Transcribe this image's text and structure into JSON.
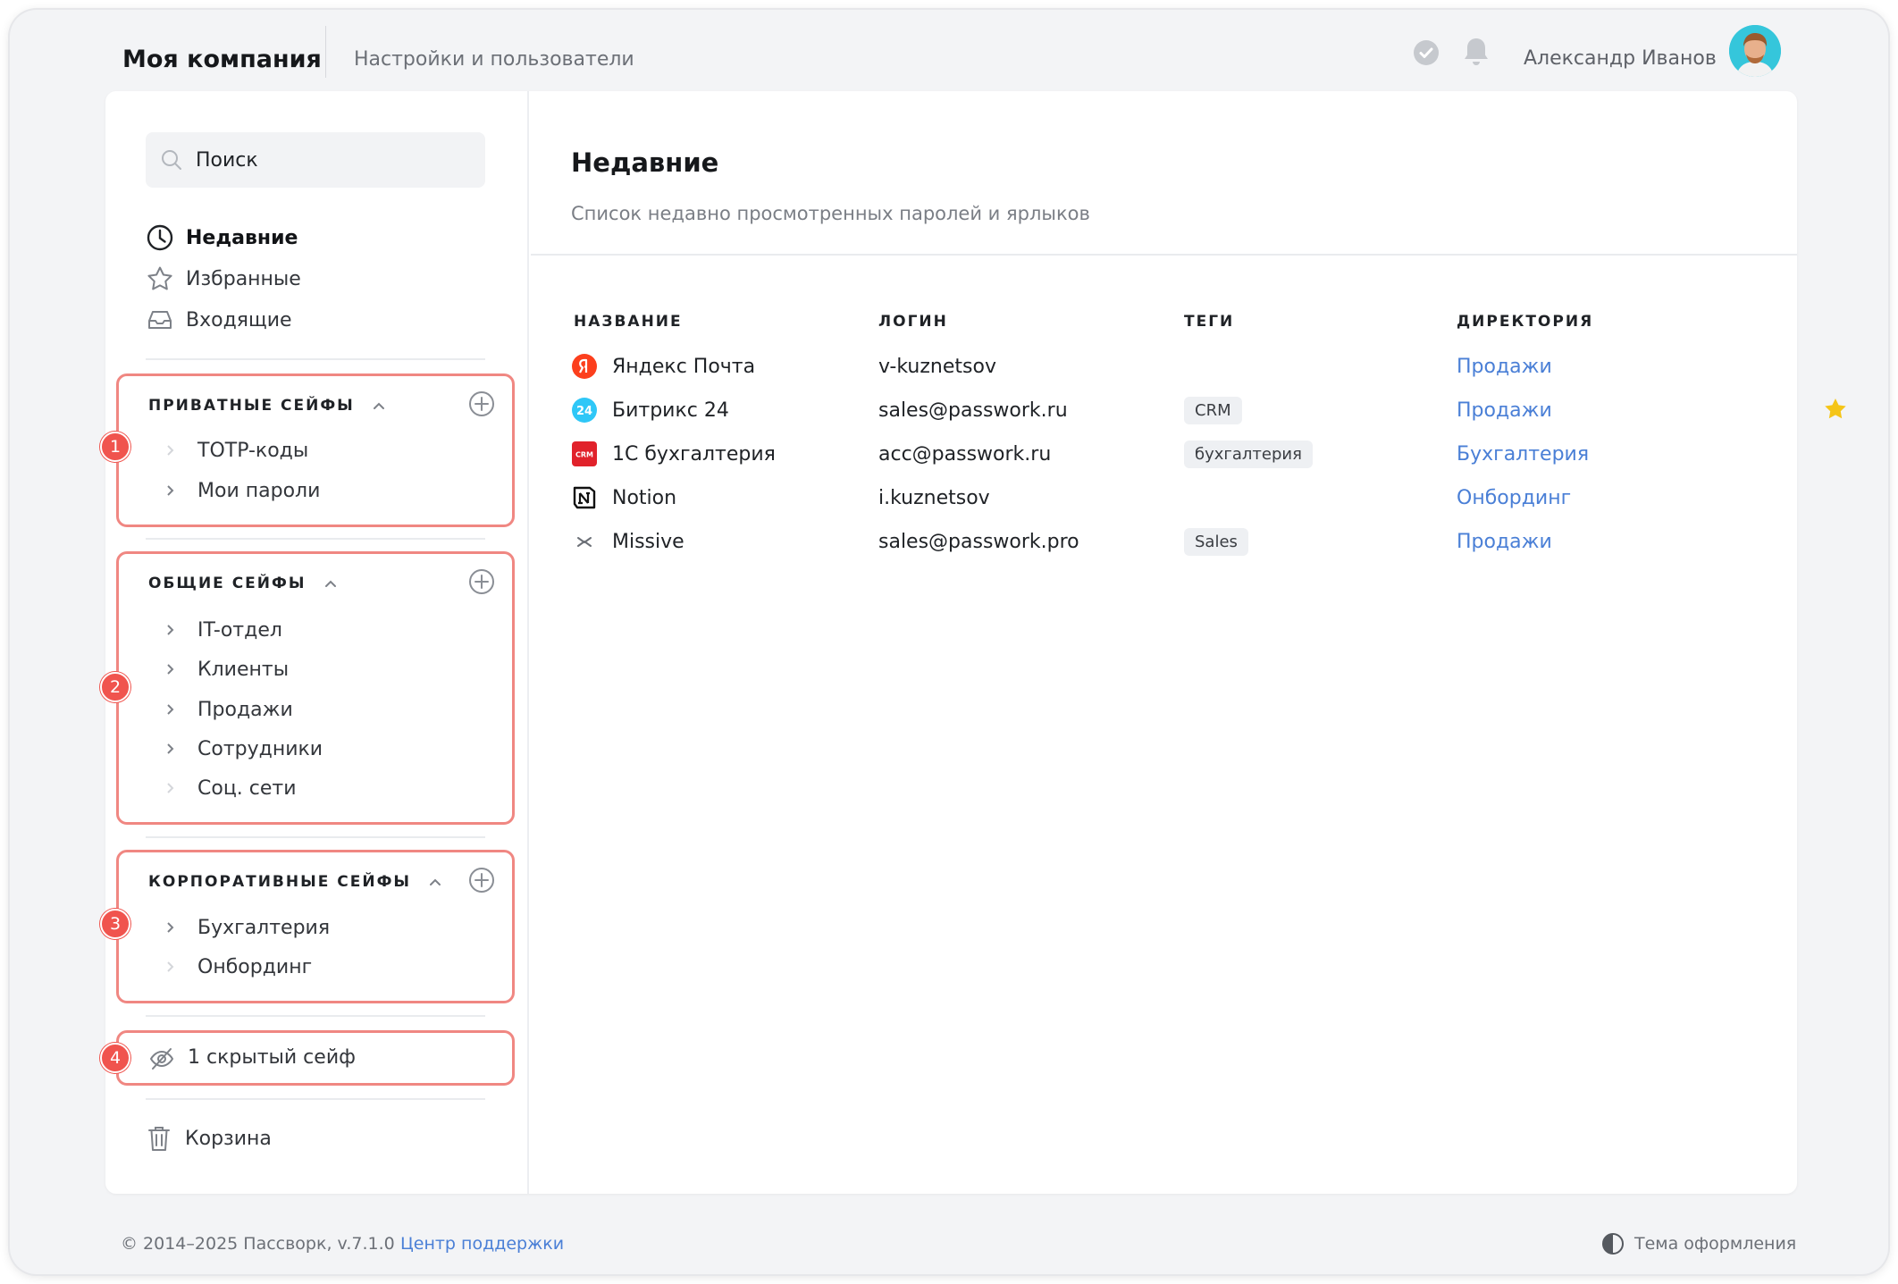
{
  "app": {
    "company": "Моя компания",
    "breadcrumb": "Настройки и пользователи",
    "user_name": "Александр Иванов"
  },
  "sidebar": {
    "search_placeholder": "Поиск",
    "nav": [
      {
        "label": "Недавние",
        "icon": "clock-icon",
        "active": true
      },
      {
        "label": "Избранные",
        "icon": "star-icon",
        "active": false
      },
      {
        "label": "Входящие",
        "icon": "inbox-icon",
        "active": false
      }
    ],
    "groups": [
      {
        "title": "ПРИВАТНЫЕ СЕЙФЫ",
        "marker": "1",
        "items": [
          "TOTP-коды",
          "Мои пароли"
        ]
      },
      {
        "title": "ОБЩИЕ СЕЙФЫ",
        "marker": "2",
        "items": [
          "IT-отдел",
          "Клиенты",
          "Продажи",
          "Сотрудники",
          "Соц. сети"
        ]
      },
      {
        "title": "КОРПОРАТИВНЫЕ СЕЙФЫ",
        "marker": "3",
        "items": [
          "Бухгалтерия",
          "Онбординг"
        ]
      }
    ],
    "hidden": {
      "label": "1 скрытый сейф",
      "marker": "4"
    },
    "trash": "Корзина"
  },
  "content": {
    "title": "Недавние",
    "subtitle": "Список недавно просмотренных паролей и ярлыков",
    "columns": [
      "НАЗВАНИЕ",
      "ЛОГИН",
      "ТЕГИ",
      "ДИРЕКТОРИЯ"
    ],
    "rows": [
      {
        "name": "Яндекс Почта",
        "icon": "yandex-icon",
        "login": "v-kuznetsov",
        "tag": "",
        "directory": "Продажи",
        "favorite": false
      },
      {
        "name": "Битрикс 24",
        "icon": "bitrix24-icon",
        "login": "sales@passwork.ru",
        "tag": "CRM",
        "directory": "Продажи",
        "favorite": true
      },
      {
        "name": "1С бухгалтерия",
        "icon": "1c-crm-icon",
        "login": "acc@passwork.ru",
        "tag": "бухгалтерия",
        "directory": "Бухгалтерия",
        "favorite": false
      },
      {
        "name": "Notion",
        "icon": "notion-icon",
        "login": "i.kuznetsov",
        "tag": "",
        "directory": "Онбординг",
        "favorite": false
      },
      {
        "name": "Missive",
        "icon": "missive-icon",
        "login": "sales@passwork.pro",
        "tag": "Sales",
        "directory": "Продажи",
        "favorite": false
      }
    ],
    "logo_badges": {
      "bitrix24": "24",
      "1c": "CRM"
    }
  },
  "footer": {
    "copyright": "© 2014–2025 Пассворк, v.7.1.0",
    "support": "Центр поддержки",
    "theme": "Тема оформления"
  },
  "colors": {
    "accent_link": "#4a7fd6",
    "marker": "#f0544e",
    "highlight_border": "#f08782",
    "star": "#f5c518"
  }
}
